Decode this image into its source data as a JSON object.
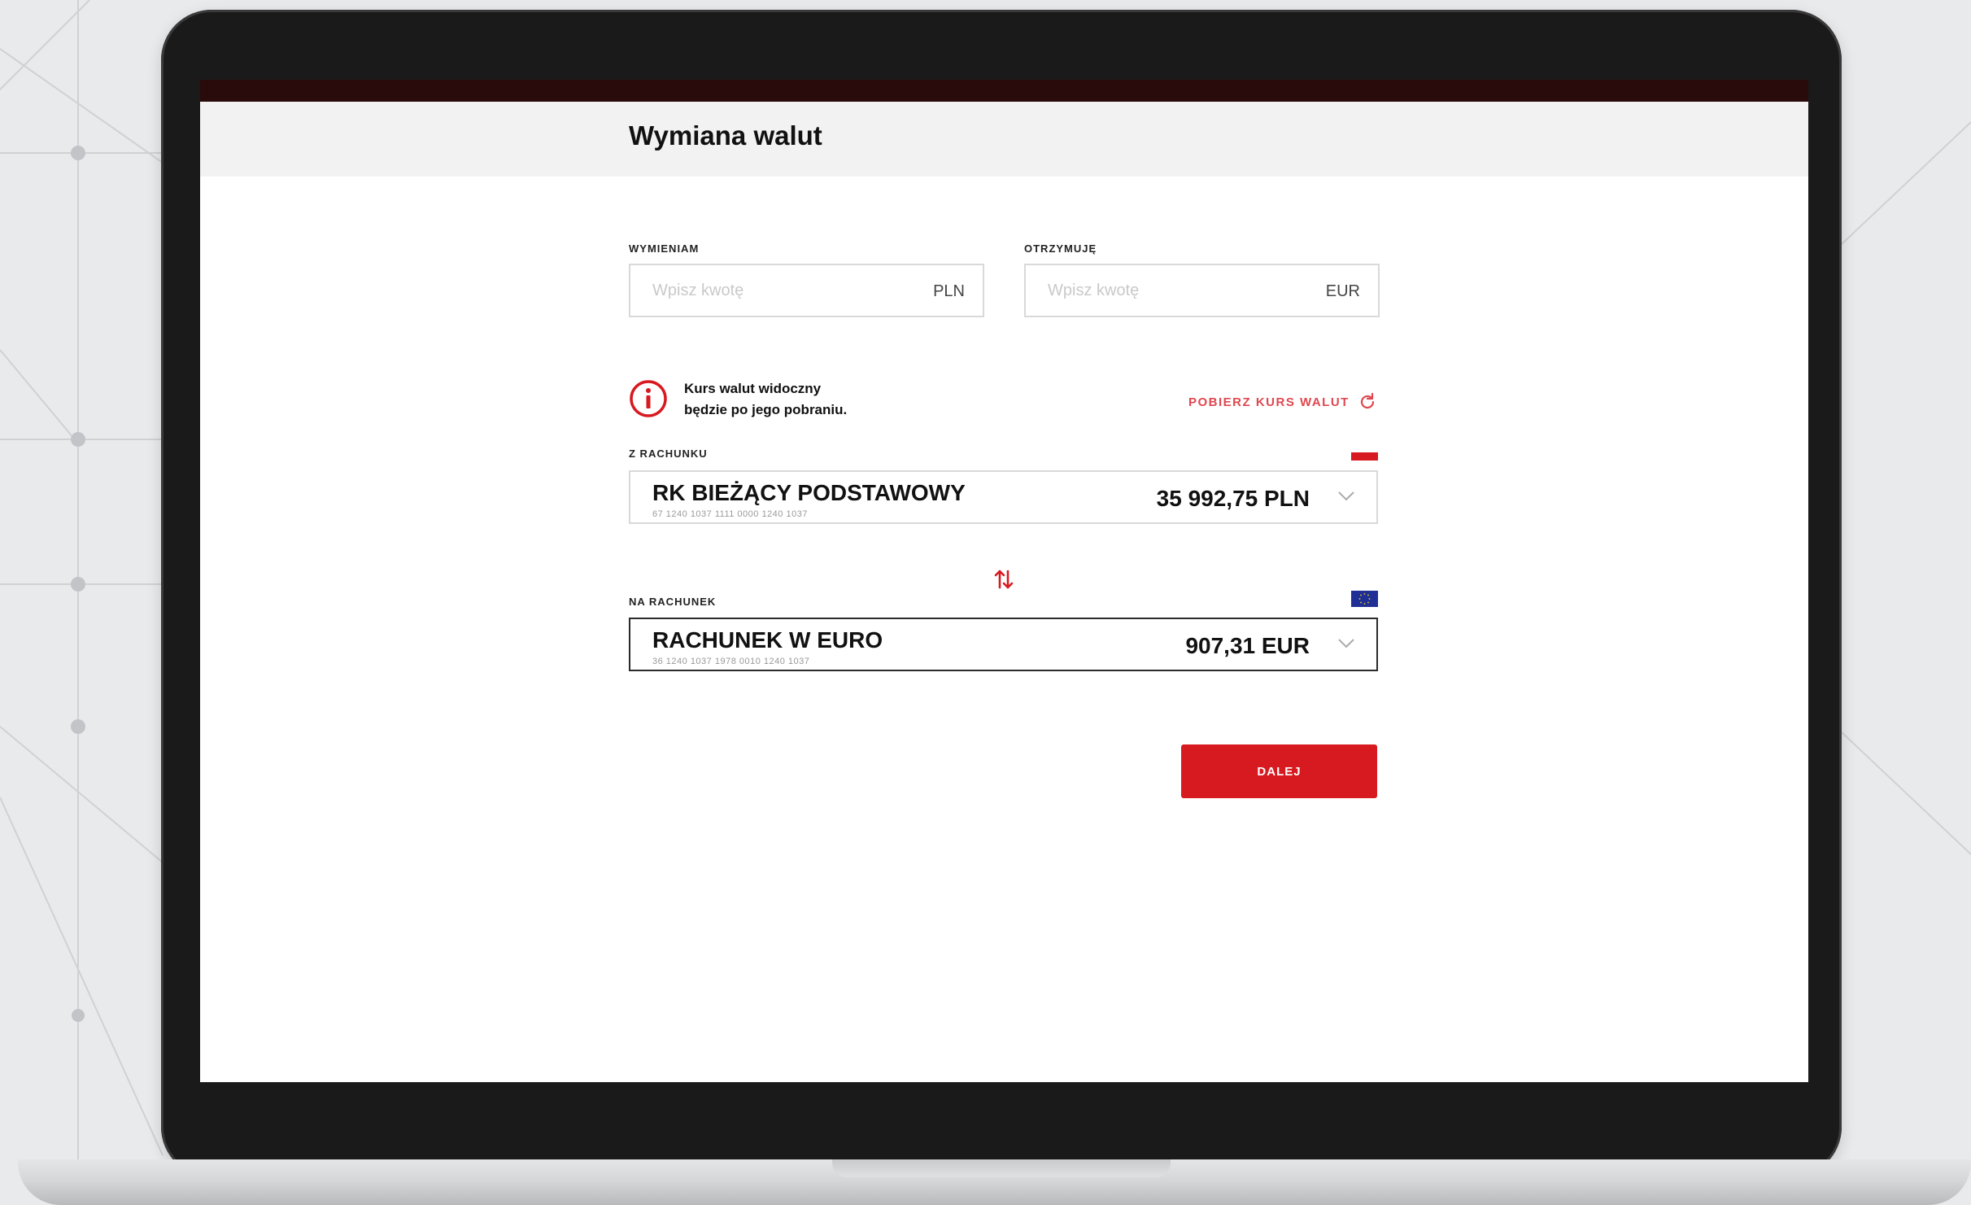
{
  "page": {
    "title": "Wymiana walut"
  },
  "exchange": {
    "from": {
      "label": "WYMIENIAM",
      "placeholder": "Wpisz kwotę",
      "currency": "PLN"
    },
    "to": {
      "label": "OTRZYMUJĘ",
      "placeholder": "Wpisz kwotę",
      "currency": "EUR"
    }
  },
  "info": {
    "line1": "Kurs walut widoczny",
    "line2": "będzie po jego pobraniu.",
    "fetch_label": "POBIERZ KURS WALUT"
  },
  "from_account": {
    "label": "Z RACHUNKU",
    "name": "RK BIEŻĄCY PODSTAWOWY",
    "number": "67 1240 1037 1111 0000 1240 1037",
    "balance": "35 992,75 PLN"
  },
  "to_account": {
    "label": "NA RACHUNEK",
    "name": "RACHUNEK W EURO",
    "number": "36 1240 1037 1978 0010 1240 1037",
    "balance": "907,31 EUR"
  },
  "actions": {
    "next_label": "DALEJ"
  },
  "colors": {
    "accent": "#d71920",
    "link": "#e0474f",
    "header_bg": "#f2f2f2",
    "topbar": "#2a0b0c"
  },
  "icons": {
    "info": "info-circle-icon",
    "refresh": "refresh-icon",
    "swap": "swap-arrows-icon",
    "chevron": "chevron-down-icon"
  }
}
